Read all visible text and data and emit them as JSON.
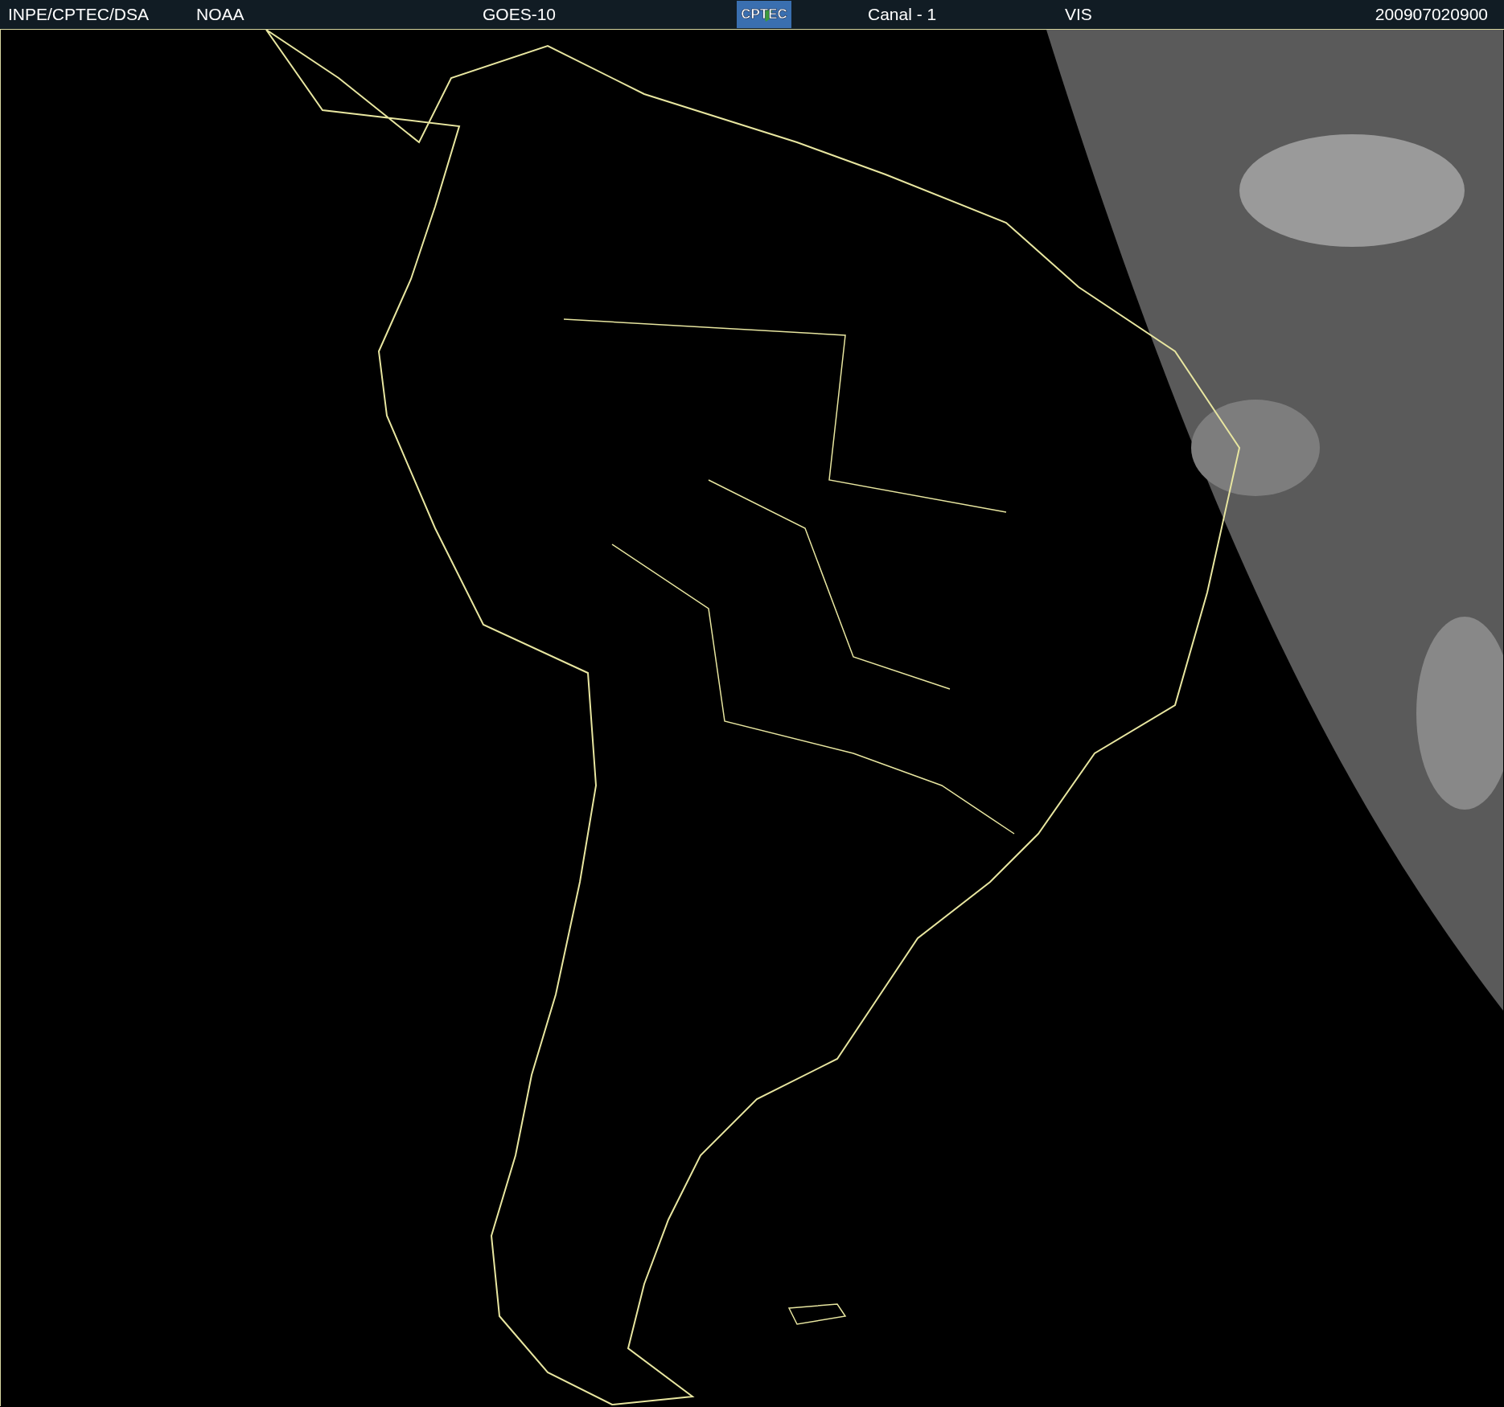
{
  "header": {
    "source": "INPE/CPTEC/DSA",
    "agency": "NOAA",
    "satellite": "GOES-10",
    "logo_text": "CPTEC",
    "channel": "Canal - 1",
    "band": "VIS",
    "timestamp": "200907020900"
  }
}
